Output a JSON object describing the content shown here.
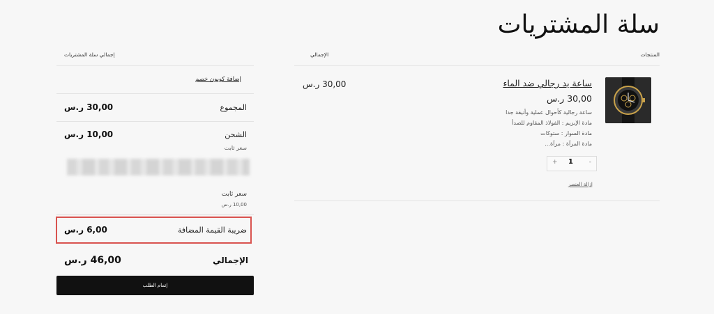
{
  "page": {
    "title": "سلة المشتريات"
  },
  "cart_table": {
    "col_products": "المنتجات",
    "col_total": "الإجمالي"
  },
  "product": {
    "name": "ساعة يد رجالي ضد الماء",
    "price": "30,00 ر.س",
    "attributes": [
      "ساعة رجالية كأحوال عملية وأنيقة جدا",
      "مادة الإبزيم : الفولاذ المقاوم للصدأ",
      "مادة السوار : ستوكات",
      "مادة المرآة : مرآة..."
    ],
    "quantity": "1",
    "qty_minus": "-",
    "qty_plus": "+",
    "remove_label": "إزالة العنصر",
    "line_total": "30,00 ر.س",
    "image_icon": "wristwatch-image"
  },
  "summary": {
    "heading": "إجمالي سلة المشتريات",
    "coupon_link": "إضافة كوبون خصم",
    "subtotal_label": "المجموع",
    "subtotal_value": "30,00 ر.س",
    "shipping_label": "الشحن",
    "shipping_value": "10,00 ر.س",
    "shipping_method": "سعر ثابت",
    "shipping_option_name": "سعر ثابت",
    "shipping_option_price": "10,00 ر.س",
    "vat_label": "ضريبة القيمة المضافة",
    "vat_value": "6,00 ر.س",
    "total_label": "الإجمالي",
    "total_value": "46,00 ر.س",
    "checkout_label": "إتمام الطلب"
  },
  "colors": {
    "highlight": "#d9534f",
    "button_bg": "#111111",
    "background": "#f7f7f7"
  }
}
